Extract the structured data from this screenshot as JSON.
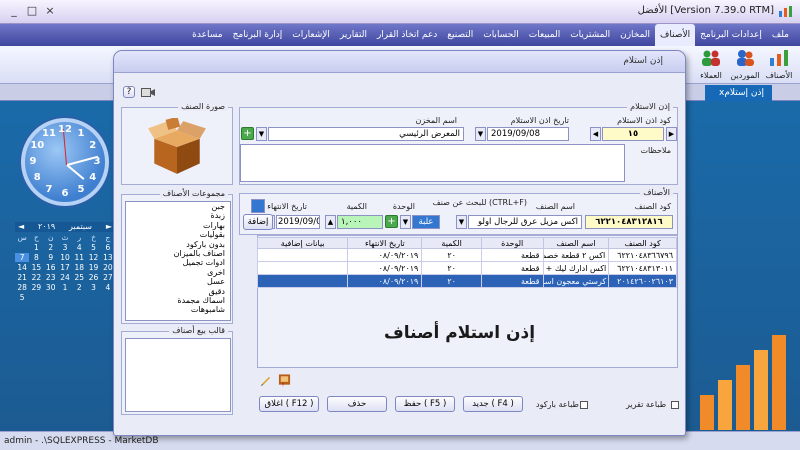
{
  "app": {
    "title": "[Version 7.39.0 RTM] الأفضل"
  },
  "menu": {
    "items": [
      "ملف",
      "إعدادات البرنامج",
      "الأصناف",
      "المخازن",
      "المشتريات",
      "المبيعات",
      "الحسابات",
      "التصنيع",
      "دعم اتخاذ القرار",
      "التقارير",
      "الإشعارات",
      "إدارة البرنامج",
      "مساعدة"
    ]
  },
  "toolbar": {
    "items": [
      "الأصناف",
      "الموردين",
      "العملاء"
    ]
  },
  "doc_tab": {
    "label": "إذن إستلام",
    "close": "x"
  },
  "status": {
    "text": "admin  -  .\\SQLEXPRESS  -  MarketDB"
  },
  "clock": {
    "numbers": [
      "12",
      "1",
      "2",
      "3",
      "4",
      "5",
      "6",
      "7",
      "8",
      "9",
      "10",
      "11"
    ]
  },
  "calendar": {
    "month": "سبتمبر",
    "year": "٢٠١٩",
    "days_of_week": [
      "س",
      "ح",
      "ن",
      "ث",
      "ر",
      "خ",
      "ج"
    ],
    "days": [
      "",
      "1",
      "2",
      "3",
      "4",
      "5",
      "6",
      "7",
      "8",
      "9",
      "10",
      "11",
      "12",
      "13",
      "14",
      "15",
      "16",
      "17",
      "18",
      "19",
      "20",
      "21",
      "22",
      "23",
      "24",
      "25",
      "26",
      "27",
      "28",
      "29",
      "30",
      "1",
      "2",
      "3",
      "4",
      "5"
    ],
    "today": "7"
  },
  "dialog": {
    "title": "إذن استلام",
    "help": "?",
    "photo_legend": "صورة الصنف",
    "header_legend": "إذن الاستلام",
    "code_label": "كود اذن الاستلام",
    "code_value": "١٥",
    "date_label": "تاريخ اذن الاستلام",
    "date_value": "2019/09/08",
    "store_label": "اسم المخزن",
    "store_value": "المعرض الرئيسي",
    "notes_label": "ملاحظات",
    "items_legend": "الأصناف",
    "item_code_label": "كود الصنف",
    "item_code_value": "٦٢٢١٠٤٨٣١٢٨١٦",
    "item_name_label": "اسم الصنف",
    "search_hint": "للبحث عن صنف (CTRL+F)",
    "item_name_value": "اكس مزيل عرق للرجال اولو",
    "unit_label": "الوحدة",
    "unit_value": "علبة",
    "qty_label": "الكمية",
    "qty_value": "١,٠٠٠",
    "expiry_label": "تاريخ الانتهاء",
    "expiry_value": "2019/09/08",
    "add_button": "إضافة",
    "groups_legend": "مجموعات الأصناف",
    "groups": [
      "جبن",
      "زبدة",
      "بهارات",
      "بقوليات",
      "بدون باركود",
      "اصناف بالميزان",
      "ادوات تجميل",
      "اخرى",
      "عسل",
      "دقيق",
      "اسماك مجمدة",
      "شامبوهات"
    ],
    "template_legend": "قالب بيع أصناف",
    "watermark": "إذن استلام أصناف",
    "buttons": {
      "close": "اغلاق ( F12 )",
      "delete": "حذف",
      "save": "حفظ ( F5 )",
      "new": "جديد ( F4 )"
    },
    "checks": {
      "print_barcode": "طباعة باركود",
      "print_report": "طباعة تقرير"
    }
  },
  "table": {
    "headers": [
      "كود الصنف",
      "اسم الصنف",
      "الوحدة",
      "الكمية",
      "تاريخ الانتهاء",
      "بيانات إضافية"
    ],
    "rows": [
      [
        "٦٢٢١٠٤٨٣٦٦٧٩٦",
        "اكس ٢ قطعة خصم ...",
        "قطعة",
        "٢٠",
        "٠٨/٠٩/٢٠١٩",
        ""
      ],
      [
        "٦٢٢١٠٤٨٣١٣٠١١",
        "اكس ادارك ليك + ...",
        "قطعة",
        "٢٠",
        "٠٨/٠٩/٢٠١٩",
        ""
      ],
      [
        "٢٠١٤٢٦٠٠٢٦١٠٣",
        "كرستي معجون اسنا...",
        "قطعة",
        "٢٠",
        "٠٨/٠٩/٢٠١٩",
        ""
      ]
    ]
  }
}
